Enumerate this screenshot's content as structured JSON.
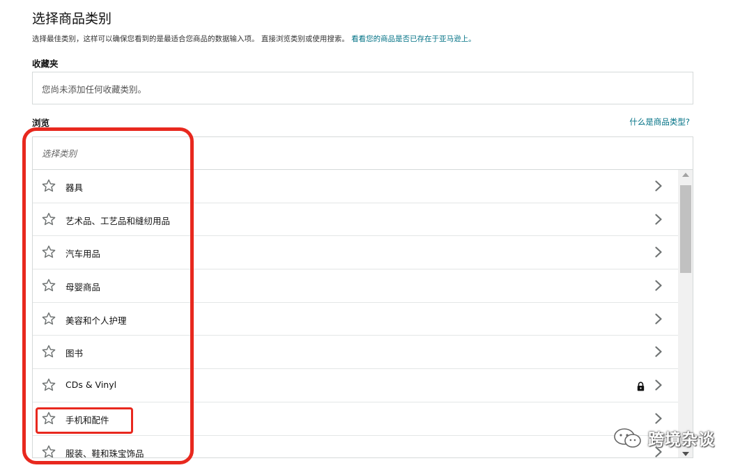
{
  "page": {
    "title": "选择商品类别",
    "intro_text": "选择最佳类别，这样可以确保您看到的是最适合您商品的数据输入项。 直接浏览类别或使用搜索。",
    "intro_link": "看看您的商品是否已存在于亚马逊上。"
  },
  "favorites": {
    "label": "收藏夹",
    "empty_text": "您尚未添加任何收藏类别。"
  },
  "browse": {
    "label": "浏览",
    "help_link": "什么是商品类型?",
    "search_placeholder": "选择类别",
    "items": [
      {
        "label": "器具",
        "locked": false
      },
      {
        "label": "艺术品、工艺品和缝纫用品",
        "locked": false
      },
      {
        "label": "汽车用品",
        "locked": false
      },
      {
        "label": "母婴商品",
        "locked": false
      },
      {
        "label": "美容和个人护理",
        "locked": false
      },
      {
        "label": "图书",
        "locked": false
      },
      {
        "label": "CDs & Vinyl",
        "locked": true
      },
      {
        "label": "手机和配件",
        "locked": false
      },
      {
        "label": "服装、鞋和珠宝饰品",
        "locked": false
      }
    ]
  },
  "icons": {
    "favorite": "star-outline-icon",
    "expand": "chevron-right-icon",
    "restricted": "lock-icon"
  },
  "colors": {
    "link": "#007185",
    "highlight": "#e8281e",
    "border": "#d5d9d9"
  },
  "watermark": {
    "text": "跨境杂谈"
  }
}
